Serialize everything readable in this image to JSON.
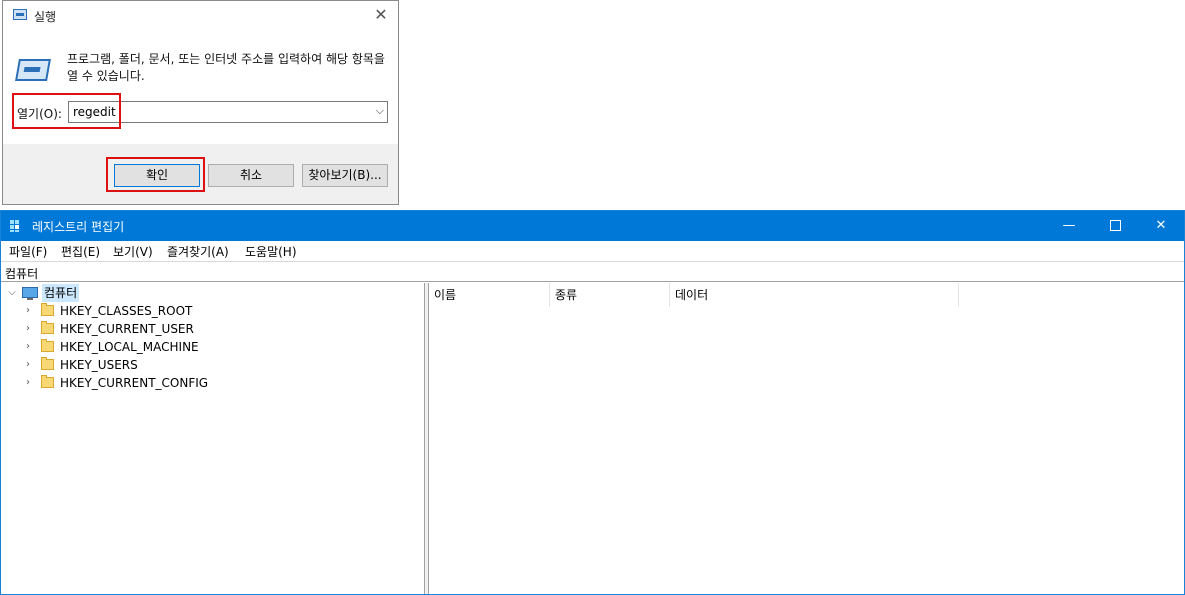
{
  "run_dialog": {
    "title": "실행",
    "description": "프로그램, 폴더, 문서, 또는 인터넷 주소를 입력하여 해당 항목을 열 수 있습니다.",
    "open_label": "열기(O):",
    "open_value": "regedit",
    "buttons": {
      "ok": "확인",
      "cancel": "취소",
      "browse": "찾아보기(B)..."
    },
    "icons": {
      "app": "run-icon",
      "close": "close-icon"
    }
  },
  "regedit": {
    "title": "레지스트리 편집기",
    "window_controls": {
      "minimize": "—",
      "close": "✕"
    },
    "menu": [
      "파일(F)",
      "편집(E)",
      "보기(V)",
      "즐겨찾기(A)",
      "도움말(H)"
    ],
    "address": "컴퓨터",
    "tree": {
      "root": "컴퓨터",
      "keys": [
        "HKEY_CLASSES_ROOT",
        "HKEY_CURRENT_USER",
        "HKEY_LOCAL_MACHINE",
        "HKEY_USERS",
        "HKEY_CURRENT_CONFIG"
      ]
    },
    "columns": [
      "이름",
      "종류",
      "데이터"
    ],
    "colors": {
      "titlebar": "#0078d7",
      "highlight_box": "#dd1111"
    }
  }
}
